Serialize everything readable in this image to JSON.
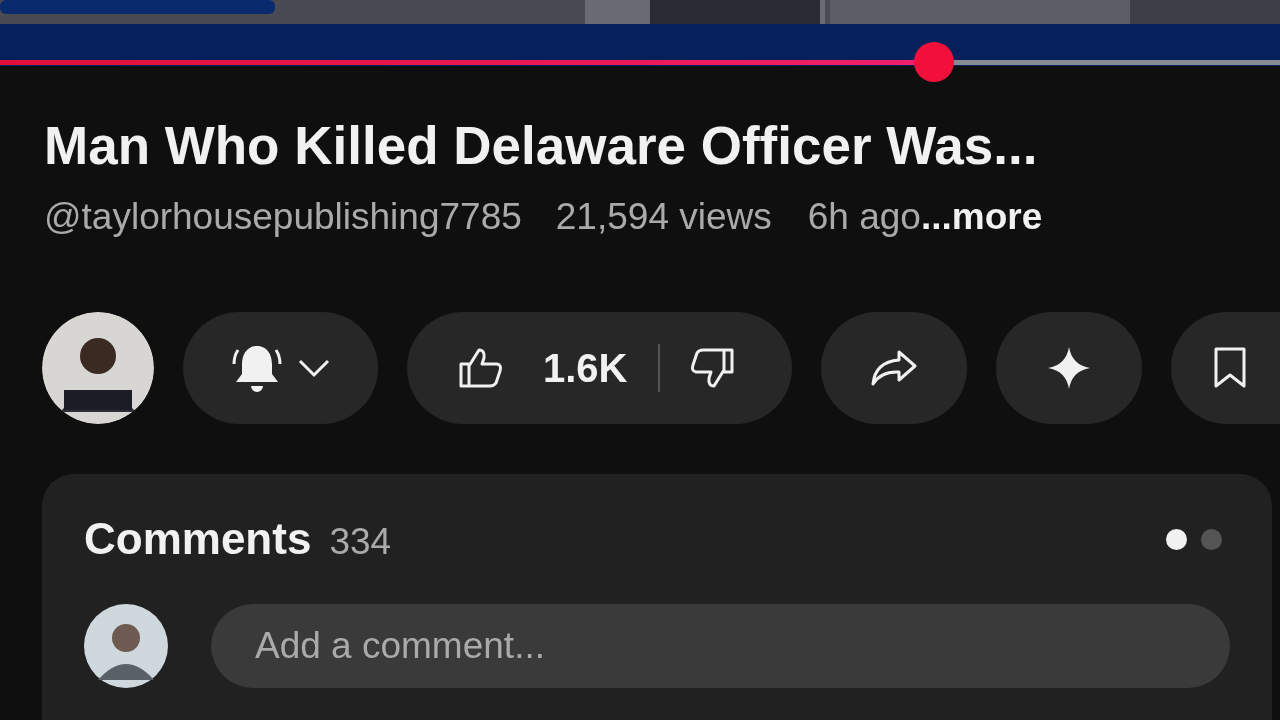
{
  "video": {
    "progress": {
      "level": 0.73
    }
  },
  "title": "Man Who Killed Delaware Officer Was...",
  "meta": {
    "channel": "@taylorhousepublishing7785",
    "views": "21,594 views",
    "age": "6h ago",
    "more": "...more"
  },
  "actions": {
    "likes": "1.6K"
  },
  "comments": {
    "title": "Comments",
    "count": "334",
    "pages": [
      {
        "selected": true
      },
      {
        "selected": false
      }
    ],
    "input": {
      "placeholder": "Add a comment..."
    }
  }
}
